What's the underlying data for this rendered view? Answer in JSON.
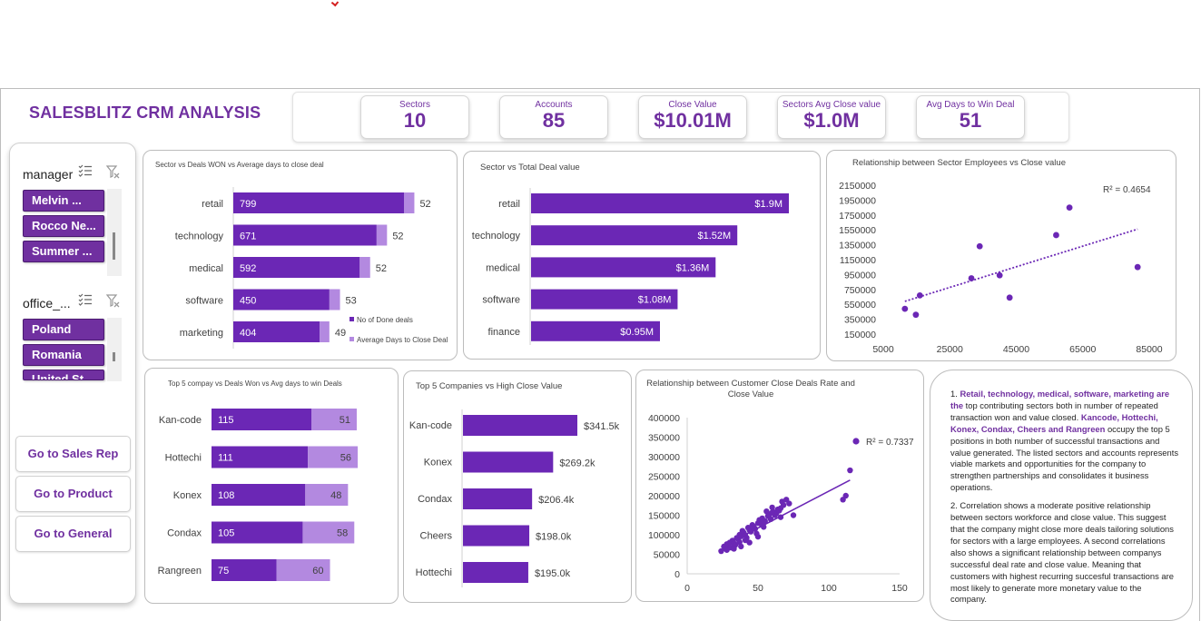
{
  "header": {
    "title": "SALESBLITZ CRM ANALYSIS",
    "kpis": [
      {
        "label": "Sectors",
        "value": "10"
      },
      {
        "label": "Accounts",
        "value": "85"
      },
      {
        "label": "Close Value",
        "value": "$10.01M"
      },
      {
        "label": "Sectors  Avg Close value",
        "value": "$1.0M"
      },
      {
        "label": "Avg Days to Win Deal",
        "value": "51"
      }
    ]
  },
  "sidebar": {
    "manager_slicer": {
      "title": "manager",
      "items": [
        "Melvin ...",
        "Rocco Ne...",
        "Summer ..."
      ]
    },
    "office_slicer": {
      "title": "office_...",
      "items": [
        "Poland",
        "Romania",
        "United St..."
      ]
    },
    "nav_buttons": [
      "Go to Sales Rep",
      "Go to Product",
      "Go to General"
    ],
    "icons": {
      "multiselect": "multi-select-icon",
      "clear_filter": "clear-filter-icon"
    }
  },
  "colors": {
    "accent": "#7030a0",
    "bar_dark": "#6b27b5",
    "bar_light": "#b389e0"
  },
  "notes": {
    "p1_highlight": "Retail, technology, medical, software, marketing are the",
    "p1_a": " top contributing sectors both in number of repeated transaction  won and value closed. ",
    "p1_highlight2": "Kancode, Hottechi, Konex, Condax, Cheers and Rangreen",
    "p1_b": " occupy the top 5 positions in both  number of successful transactions and value generated. The listed sectors and accounts represents viable markets and opportunities for the company to strengthen partnerships  and consolidates it business operations.",
    "p2": "2. Correlation shows a moderate positive relationship between sectors workforce and close value. This suggest that the company might close more deals tailoring solutions for sectors with a large employees. A second correlations also shows  a significant relationship between companys successful deal rate and close value. Meaning that customers with highest recurring succesful transactions are most likely to generate more monetary value  to the company.",
    "p1_prefix": "1. "
  },
  "chart_data": [
    {
      "type": "bar",
      "title": "Sector vs Deals WON vs Average days to close deal",
      "categories": [
        "retail",
        "technology",
        "medical",
        "software",
        "marketing"
      ],
      "series": [
        {
          "name": "No of Done deals",
          "values": [
            799,
            671,
            592,
            450,
            404
          ]
        },
        {
          "name": "Average Days to Close Deal",
          "values": [
            52,
            52,
            52,
            53,
            49
          ]
        }
      ],
      "stacked": true,
      "orientation": "horizontal",
      "legend": "bottom-right"
    },
    {
      "type": "bar",
      "title": "Sector vs Total Deal value",
      "categories": [
        "retail",
        "technology",
        "medical",
        "software",
        "finance"
      ],
      "values": [
        1900000,
        1520000,
        1360000,
        1080000,
        950000
      ],
      "labels": [
        "$1.9M",
        "$1.52M",
        "$1.36M",
        "$1.08M",
        "$0.95M"
      ],
      "orientation": "horizontal"
    },
    {
      "type": "scatter",
      "title": "Relationship between Sector Employees vs Close value",
      "x": [
        11500,
        14800,
        16000,
        31500,
        34000,
        40000,
        43000,
        57000,
        61000,
        81500
      ],
      "y": [
        490000,
        410000,
        670000,
        900000,
        1330000,
        940000,
        640000,
        1480000,
        1850000,
        1050000
      ],
      "trendline": {
        "x": [
          11500,
          81500
        ],
        "y": [
          590000,
          1560000
        ]
      },
      "r2_label": "R² = 0.4654",
      "xticks": [
        "5000",
        "25000",
        "45000",
        "65000",
        "85000"
      ],
      "yticks": [
        "2150000",
        "1950000",
        "1750000",
        "1550000",
        "1350000",
        "1150000",
        "950000",
        "750000",
        "550000",
        "350000",
        "150000"
      ],
      "xlim": [
        5000,
        85000
      ],
      "ylim": [
        150000,
        2150000
      ]
    },
    {
      "type": "bar",
      "title": "Top 5 compay vs Deals Won vs Avg  days to win Deals",
      "categories": [
        "Kan-code",
        "Hottechi",
        "Konex",
        "Condax",
        "Rangreen"
      ],
      "series": [
        {
          "name": "Deals Won",
          "values": [
            115,
            111,
            108,
            105,
            75
          ]
        },
        {
          "name": "Avg days to win",
          "values": [
            51,
            56,
            48,
            58,
            60
          ]
        }
      ],
      "stacked": true,
      "orientation": "horizontal"
    },
    {
      "type": "bar",
      "title": "Top 5 Companies vs High Close Value",
      "categories": [
        "Kan-code",
        "Konex",
        "Condax",
        "Cheers",
        "Hottechi"
      ],
      "values": [
        341500,
        269200,
        206400,
        198000,
        195000
      ],
      "labels": [
        "$341.5k",
        "$269.2k",
        "$206.4k",
        "$198.0k",
        "$195.0k"
      ],
      "orientation": "horizontal"
    },
    {
      "type": "scatter",
      "title": "Relationship between Customer Close Deals Rate and Close Value",
      "x": [
        24,
        26,
        27,
        28,
        29,
        30,
        31,
        32,
        33,
        34,
        35,
        36,
        37,
        37,
        38,
        38,
        39,
        40,
        41,
        42,
        43,
        44,
        44,
        45,
        46,
        47,
        48,
        49,
        50,
        50,
        51,
        52,
        53,
        54,
        55,
        56,
        57,
        58,
        59,
        60,
        61,
        62,
        63,
        64,
        65,
        66,
        67,
        68,
        70,
        72,
        75,
        28,
        33,
        41,
        47,
        53,
        60,
        66,
        112,
        115,
        110
      ],
      "y": [
        58000,
        70000,
        65000,
        76000,
        72000,
        80000,
        67000,
        85000,
        78000,
        74000,
        92000,
        88000,
        81000,
        100000,
        96000,
        70000,
        110000,
        105000,
        99000,
        92000,
        118000,
        112000,
        80000,
        108000,
        125000,
        121000,
        115000,
        103000,
        130000,
        95000,
        138000,
        128000,
        142000,
        120000,
        135000,
        160000,
        148000,
        152000,
        140000,
        170000,
        158000,
        150000,
        155000,
        165000,
        162000,
        145000,
        185000,
        176000,
        190000,
        180000,
        150000,
        61000,
        64000,
        86000,
        116000,
        128000,
        157000,
        168000,
        200000,
        265000,
        190000
      ],
      "trendline": {
        "x": [
          24,
          115
        ],
        "y": [
          68000,
          240000
        ]
      },
      "r2_label": "R² = 0.7337",
      "xticks": [
        "0",
        "50",
        "100",
        "150"
      ],
      "yticks": [
        "400000",
        "350000",
        "300000",
        "250000",
        "200000",
        "150000",
        "100000",
        "50000",
        "0"
      ],
      "xlim": [
        0,
        150
      ],
      "ylim": [
        0,
        400000
      ]
    }
  ]
}
